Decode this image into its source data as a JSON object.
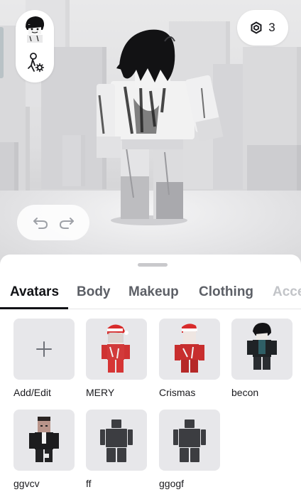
{
  "robux": {
    "count": "3",
    "icon": "robux-icon"
  },
  "undo_redo": {
    "undo_icon": "undo-icon",
    "redo_icon": "redo-icon"
  },
  "tabs": [
    {
      "label": "Avatars",
      "active": true
    },
    {
      "label": "Body"
    },
    {
      "label": "Makeup"
    },
    {
      "label": "Clothing"
    },
    {
      "label": "Acce"
    }
  ],
  "avatars": [
    {
      "label": "Add/Edit",
      "icon": "plus-icon"
    },
    {
      "label": "MERY",
      "icon": "avatar-mery-thumbnail"
    },
    {
      "label": "Crismas",
      "icon": "avatar-crismas-thumbnail"
    },
    {
      "label": "becon",
      "icon": "avatar-becon-thumbnail"
    },
    {
      "label": "ggvcv",
      "icon": "avatar-ggvcv-thumbnail"
    },
    {
      "label": "ff",
      "icon": "default-avatar-silhouette"
    },
    {
      "label": "ggogf",
      "icon": "default-avatar-silhouette"
    }
  ]
}
